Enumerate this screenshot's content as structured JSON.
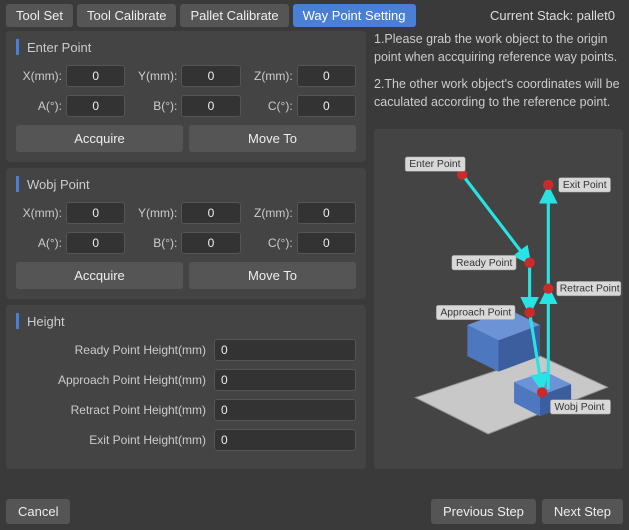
{
  "tabs": {
    "tool_set": "Tool Set",
    "tool_calibrate": "Tool Calibrate",
    "pallet_calibrate": "Pallet Calibrate",
    "waypoint_setting": "Way Point Setting"
  },
  "current_stack_label": "Current Stack: pallet0",
  "groups": {
    "enter_point": {
      "title": "Enter Point",
      "x_label": "X(mm):",
      "x_value": "0",
      "y_label": "Y(mm):",
      "y_value": "0",
      "z_label": "Z(mm):",
      "z_value": "0",
      "a_label": "A(°):",
      "a_value": "0",
      "b_label": "B(°):",
      "b_value": "0",
      "c_label": "C(°):",
      "c_value": "0",
      "acquire": "Accquire",
      "move_to": "Move To"
    },
    "wobj_point": {
      "title": "Wobj Point",
      "x_label": "X(mm):",
      "x_value": "0",
      "y_label": "Y(mm):",
      "y_value": "0",
      "z_label": "Z(mm):",
      "z_value": "0",
      "a_label": "A(°):",
      "a_value": "0",
      "b_label": "B(°):",
      "b_value": "0",
      "c_label": "C(°):",
      "c_value": "0",
      "acquire": "Accquire",
      "move_to": "Move To"
    },
    "height": {
      "title": "Height",
      "ready_label": "Ready Point Height(mm)",
      "ready_value": "0",
      "approach_label": "Approach Point Height(mm)",
      "approach_value": "0",
      "retract_label": "Retract Point Height(mm)",
      "retract_value": "0",
      "exit_label": "Exit Point Height(mm)",
      "exit_value": "0"
    }
  },
  "instructions": {
    "p1": "1.Please grab the work object to the origin point when accquiring reference way points.",
    "p2": "2.The other work object's coordinates will be caculated according to the reference point."
  },
  "diagram": {
    "enter_point": "Enter Point",
    "exit_point": "Exit Point",
    "ready_point": "Ready Point",
    "retract_point": "Retract Point",
    "approach_point": "Approach Point",
    "wobj_point": "Wobj Point"
  },
  "footer": {
    "cancel": "Cancel",
    "previous_step": "Previous Step",
    "next_step": "Next Step"
  }
}
